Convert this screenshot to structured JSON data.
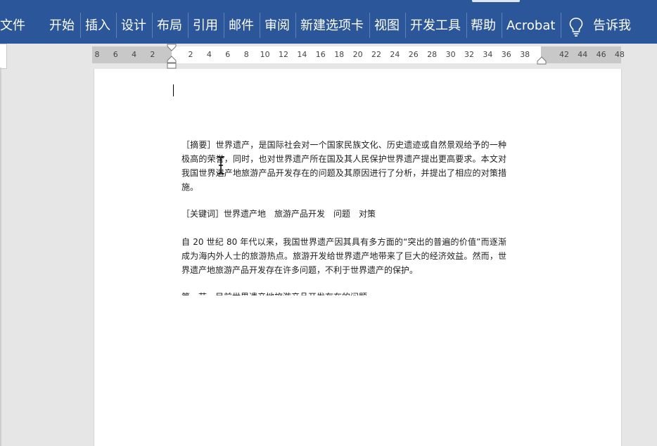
{
  "ribbon": {
    "tabs": [
      "文件",
      "开始",
      "插入",
      "设计",
      "布局",
      "引用",
      "邮件",
      "审阅",
      "新建选项卡",
      "视图",
      "开发工具",
      "帮助",
      "Acrobat"
    ],
    "tell_me": "告诉我"
  },
  "ruler": {
    "ticks_left": [
      "8",
      "6",
      "4",
      "2"
    ],
    "ticks_main": [
      "2",
      "4",
      "6",
      "8",
      "10",
      "12",
      "14",
      "16",
      "18",
      "20",
      "22",
      "24",
      "26",
      "28",
      "30",
      "32",
      "34",
      "36",
      "38"
    ],
    "ticks_right": [
      "42",
      "44",
      "46",
      "48"
    ]
  },
  "document": {
    "abstract": "［摘要］世界遗产，是国际社会对一个国家民族文化、历史遗迹或自然景观给予的一种极高的荣誉，同时，也对世界遗产所在国及其人民保护世界遗产提出更高要求。本文对我国世界遗产地旅游产品开发存在的问题及其原因进行了分析，并提出了相应的对策措施。",
    "keywords": "［关键词］世界遗产地　旅游产品开发　问题　对策",
    "intro": "自 20 世纪 80 年代以来，我国世界遗产因其具有多方面的“突出的普遍的价值”而逐渐成为海内外人士的旅游热点。旅游开发给世界遗产地带来了巨大的经济效益。然而，世界遗产地旅游产品开发存在许多问题，不利于世界遗产的保护。",
    "section_heading": "第一节　目前世界遗产地旅游产品开发存在的问题"
  },
  "colors": {
    "ribbon": "#2b579a",
    "ruler_margin": "#c8c8c8",
    "page": "#ffffff"
  }
}
